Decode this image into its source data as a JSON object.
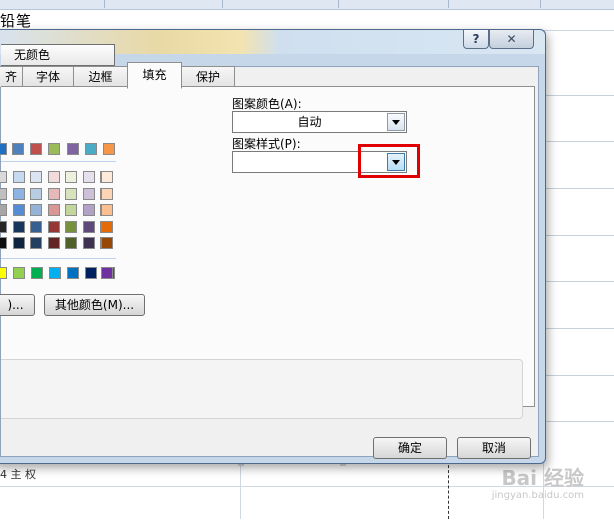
{
  "sheet": {
    "title_fragment": "铅笔",
    "left_text_fragment": "4  主 权"
  },
  "watermark": {
    "brand": "Bai 经验",
    "url": "jingyan.baidu.com"
  },
  "dialog": {
    "tabs": [
      {
        "label": "齐"
      },
      {
        "label": "字体"
      },
      {
        "label": "边框"
      },
      {
        "label": "填充"
      },
      {
        "label": "保护"
      }
    ],
    "active_tab": "填充",
    "background": {
      "no_color_label": "无颜色",
      "fill_effects_fragment": ")...",
      "more_colors_label": "其他颜色(M)...",
      "theme_row_colors": [
        "#1f6fc5",
        "#4f81bd",
        "#c0504d",
        "#9bbb59",
        "#8064a2",
        "#4bacc6",
        "#f79646"
      ],
      "tint_rows": [
        [
          "#d9d9d9",
          "#c5d9f1",
          "#dbe5f1",
          "#f2dcdb",
          "#ebf1dd",
          "#e5e0ec",
          "#dbeef3",
          "#fdeada"
        ],
        [
          "#bfbfbf",
          "#8db3e2",
          "#b8cce4",
          "#e6b8b7",
          "#d7e3bc",
          "#ccc1d9",
          "#b7dde8",
          "#fbd5b5"
        ],
        [
          "#a6a6a6",
          "#548dd4",
          "#95b3d7",
          "#d99694",
          "#c3d69b",
          "#b2a2c7",
          "#92cddc",
          "#fac08f"
        ],
        [
          "#262626",
          "#17365d",
          "#366092",
          "#953734",
          "#76923c",
          "#5f497a",
          "#31859b",
          "#e36c09"
        ],
        [
          "#0d0d0d",
          "#0f243e",
          "#244061",
          "#632423",
          "#4f6128",
          "#3f3151",
          "#205867",
          "#974806"
        ]
      ],
      "standard_colors": [
        "#ffff00",
        "#92d050",
        "#00b050",
        "#00b0f0",
        "#0070c0",
        "#002060",
        "#7030a0"
      ]
    },
    "pattern_color_label": "图案颜色(A):",
    "pattern_color_value": "自动",
    "pattern_style_label": "图案样式(P):",
    "pattern_style_value": "",
    "ok_label": "确定",
    "cancel_label": "取消",
    "help_glyph": "?",
    "close_glyph": "✕",
    "highlight_color": "#e00000"
  }
}
